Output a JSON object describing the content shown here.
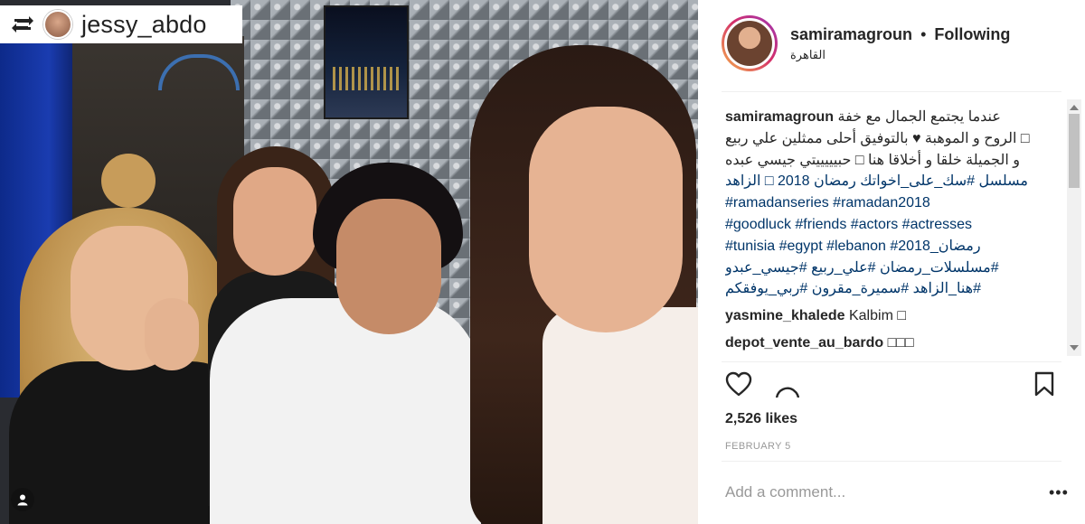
{
  "photo": {
    "repost_user": "jessy_abdo",
    "repost_icon": "repost-icon",
    "tag_icon": "person-tag-icon"
  },
  "header": {
    "username": "samiramagroun",
    "separator": "•",
    "follow_status": "Following",
    "location": "القاهرة"
  },
  "caption": {
    "username": "samiramagroun",
    "lines": [
      "عندما يجتمع الجمال مع خفة",
      "□ الروح و الموهبة ♥ بالتوفيق أحلى ممثلين علي ربيع",
      "و الجميلة خلقا و أخلاقا هنا □ حبيييييتي جيسي عبده",
      "مسلسل #سك_على_اخواتك رمضان 2018 □ الزاهد",
      "#ramadanseries #ramadan2018",
      "#goodluck #friends #actors #actresses",
      "#tunisia #egypt #lebanon #2018_رمضان",
      "#مسلسلات_رمضان #علي_ربيع #جيسي_عبدو",
      "#هنا_الزاهد #سميرة_مقرون #ربي_يوفقكم"
    ]
  },
  "comments": [
    {
      "user": "yasmine_khalede",
      "text": "Kalbim □"
    },
    {
      "user": "depot_vente_au_bardo",
      "text": "□□□"
    }
  ],
  "actions": {
    "like_icon": "heart-icon",
    "comment_icon": "comment-icon",
    "save_icon": "bookmark-icon"
  },
  "likes": "2,526 likes",
  "date": "FEBRUARY 5",
  "add_comment_placeholder": "Add a comment...",
  "more_label": "•••",
  "colors": {
    "hashtag": "#003569",
    "text": "#262626",
    "muted": "#999999",
    "story_ring_start": "#f5b04a",
    "story_ring_end": "#9b36b7"
  }
}
